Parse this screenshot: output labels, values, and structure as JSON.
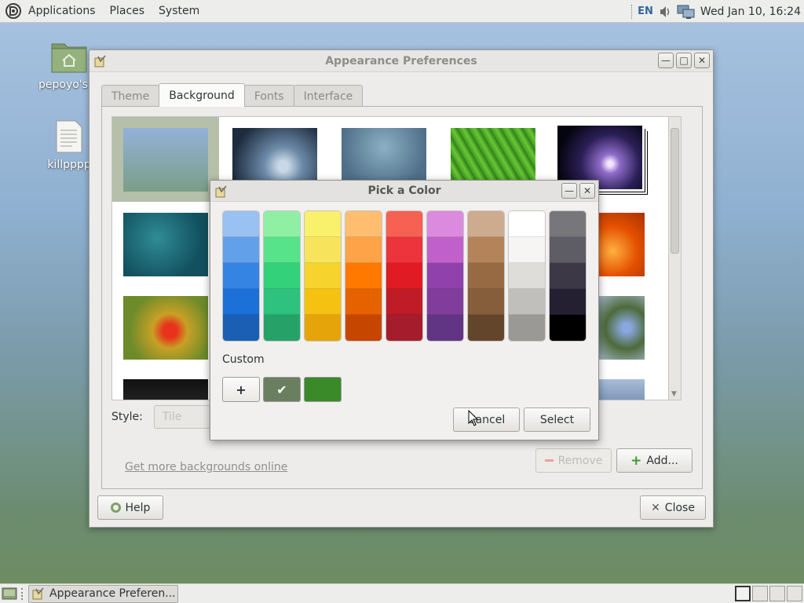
{
  "top_panel": {
    "menus": [
      "Applications",
      "Places",
      "System"
    ],
    "lang": "EN",
    "clock": "Wed Jan 10, 16:24"
  },
  "desktop": {
    "icons": [
      {
        "label": "pepoyo's H",
        "icon": "home-folder-icon"
      },
      {
        "label": "killpppp",
        "icon": "text-file-icon"
      }
    ]
  },
  "window": {
    "title": "Appearance Preferences",
    "tabs": [
      "Theme",
      "Background",
      "Fonts",
      "Interface"
    ],
    "active_tab": "Background",
    "style_label": "Style:",
    "style_value": "Tile",
    "link": "Get more backgrounds online",
    "remove_label": "Remove",
    "add_label": "Add...",
    "help_label": "Help",
    "close_label": "Close"
  },
  "dialog": {
    "title": "Pick a Color",
    "custom_label": "Custom",
    "add_custom_symbol": "+",
    "cancel_label": "Cancel",
    "select_label": "Select",
    "palette": [
      [
        "#99c1f1",
        "#62a0ea",
        "#3584e4",
        "#1c71d8",
        "#1a5fb4"
      ],
      [
        "#8ff0a4",
        "#57e389",
        "#33d17a",
        "#2ec27e",
        "#26a269"
      ],
      [
        "#f9f06b",
        "#f8e45c",
        "#f6d32d",
        "#f5c211",
        "#e5a50a"
      ],
      [
        "#ffbe6f",
        "#ffa348",
        "#ff7800",
        "#e66100",
        "#c64600"
      ],
      [
        "#f66151",
        "#ed333b",
        "#e01b24",
        "#c01c28",
        "#a51d2d"
      ],
      [
        "#dc8add",
        "#c061cb",
        "#9141ac",
        "#813d9c",
        "#613583"
      ],
      [
        "#cdab8f",
        "#b5835a",
        "#986a44",
        "#865e3c",
        "#63452c"
      ],
      [
        "#ffffff",
        "#f6f5f4",
        "#deddda",
        "#c0bfbc",
        "#9a9996"
      ],
      [
        "#77767b",
        "#5e5c64",
        "#3d3846",
        "#241f31",
        "#000000"
      ]
    ],
    "custom_colors": [
      "#6a7f60",
      "#3a8a2a"
    ]
  },
  "taskbar": {
    "task_label": "Appearance Preferen..."
  }
}
